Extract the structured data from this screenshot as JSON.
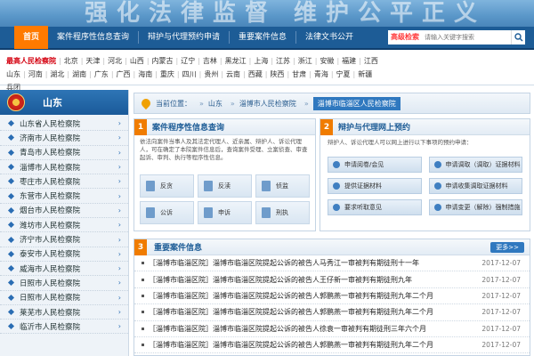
{
  "banner": {
    "slogan": "强化法律监督 维护公平正义"
  },
  "nav": {
    "items": [
      "首页",
      "案件程序性信息查询",
      "辩护与代理预约申请",
      "重要案件信息",
      "法律文书公开"
    ],
    "search_label": "高级检索",
    "search_placeholder": "请输入关键字搜索"
  },
  "provinces": {
    "row1": [
      "最高人民检察院",
      "北京",
      "天津",
      "河北",
      "山西",
      "内蒙古",
      "辽宁",
      "吉林",
      "黑龙江",
      "上海",
      "江苏",
      "浙江",
      "安徽",
      "福建",
      "江西"
    ],
    "row2": [
      "山东",
      "河南",
      "湖北",
      "湖南",
      "广东",
      "广西",
      "海南",
      "重庆",
      "四川",
      "贵州",
      "云南",
      "西藏",
      "陕西",
      "甘肃",
      "青海",
      "宁夏",
      "新疆"
    ],
    "row3": [
      "兵团"
    ],
    "active": "最高人民检察院"
  },
  "sidebar": {
    "title": "山东",
    "items": [
      "山东省人民检察院",
      "济南市人民检察院",
      "青岛市人民检察院",
      "淄博市人民检察院",
      "枣庄市人民检察院",
      "东营市人民检察院",
      "烟台市人民检察院",
      "潍坊市人民检察院",
      "济宁市人民检察院",
      "泰安市人民检察院",
      "威海市人民检察院",
      "日照市人民检察院",
      "日照市人民检察院",
      "莱芜市人民检察院",
      "临沂市人民检察院"
    ]
  },
  "breadcrumb": {
    "label": "当前位置：",
    "items": [
      "山东",
      "淄博市人民检察院"
    ],
    "current": "淄博市临淄区人民检察院"
  },
  "panel1": {
    "num": "1",
    "title": "案件程序性信息查询",
    "desc": "依法向案件当事人及其法定代理人、近亲属、辩护人、诉讼代理人，可在确定了本院案件信息后，查询案件受理、立案侦查、审查起诉、审判、执行等程序性信息。",
    "buttons": [
      "反贪",
      "反渎",
      "侦监",
      "公诉",
      "申诉",
      "刑执"
    ]
  },
  "panel2": {
    "num": "2",
    "title": "辩护与代理网上预约",
    "desc": "辩护人、诉讼代理人可以网上进行以下事项的预约申请：",
    "buttons": [
      "申请阅卷/会见",
      "申请调取（调取）证据材料",
      "提供证据材料",
      "申请收集调取证据材料",
      "要求听取意见",
      "申请变更（解除）强制措施"
    ]
  },
  "news": {
    "num": "3",
    "title": "重要案件信息",
    "more": "更多>>",
    "rows": [
      {
        "title": "［淄博市临淄区院］淄博市临淄区院提起公诉的被告人马秀江一审被判有期徒刑十一年",
        "date": "2017-12-07"
      },
      {
        "title": "［淄博市临淄区院］淄博市临淄区院提起公诉的被告人王仔新一审被判有期徒刑九年",
        "date": "2017-12-07"
      },
      {
        "title": "［淄博市临淄区院］淄博市临淄区院提起公诉的被告人郭鹏燕一审被判有期徒刑九年二个月",
        "date": "2017-12-07"
      },
      {
        "title": "［淄博市临淄区院］淄博市临淄区院提起公诉的被告人郭鹏燕一审被判有期徒刑九年二个月",
        "date": "2017-12-07"
      },
      {
        "title": "［淄博市临淄区院］淄博市临淄区院提起公诉的被告人徐袁一审被判有期徒刑三年六个月",
        "date": "2017-12-07"
      },
      {
        "title": "［淄博市临淄区院］淄博市临淄区院提起公诉的被告人郭鹏燕一审被判有期徒刑九年二个月",
        "date": "2017-12-07"
      }
    ]
  }
}
